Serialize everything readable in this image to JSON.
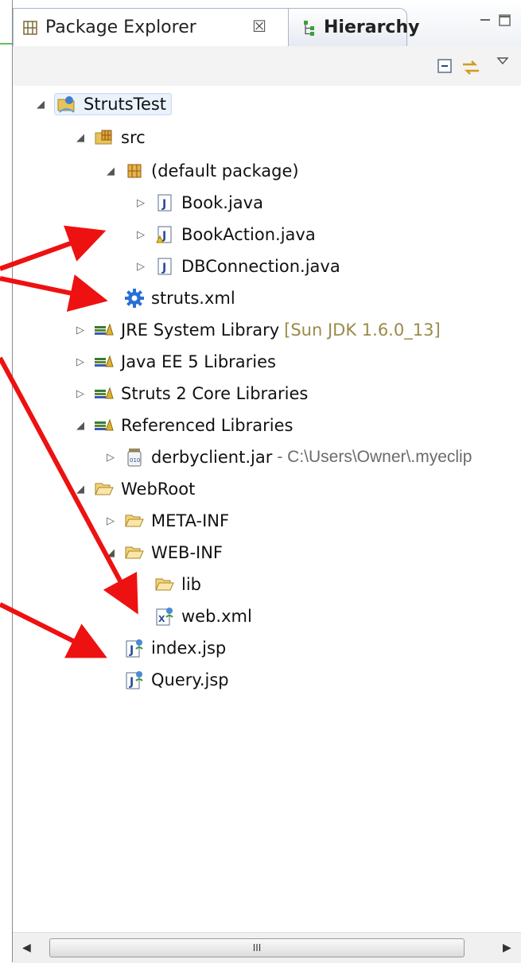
{
  "tabs": [
    {
      "label": "Package Explorer",
      "active": true
    },
    {
      "label": "Hierarchy",
      "active": false
    }
  ],
  "tab_close_glyph": "☒",
  "scroll_thumb_grip": "III",
  "tree": {
    "project": "StrutsTest",
    "src": "src",
    "default_package": "(default package)",
    "book_java": "Book.java",
    "bookaction_java": "BookAction.java",
    "dbconnection_java": "DBConnection.java",
    "struts_xml": "struts.xml",
    "jre_label": "JRE System Library",
    "jre_decoration": "[Sun JDK 1.6.0_13]",
    "javaee_lib": "Java EE 5 Libraries",
    "struts_core_lib": "Struts 2 Core Libraries",
    "referenced_libs": "Referenced Libraries",
    "derby_jar": "derbyclient.jar",
    "derby_path": "- C:\\Users\\Owner\\.myeclip",
    "webroot": "WebRoot",
    "meta_inf": "META-INF",
    "web_inf": "WEB-INF",
    "lib": "lib",
    "web_xml": "web.xml",
    "index_jsp": "index.jsp",
    "query_jsp": "Query.jsp"
  },
  "colors": {
    "annotation_arrow": "#ee1111",
    "decoration_text": "#9a8a4a",
    "selection_bg": "#eaf2fc"
  }
}
